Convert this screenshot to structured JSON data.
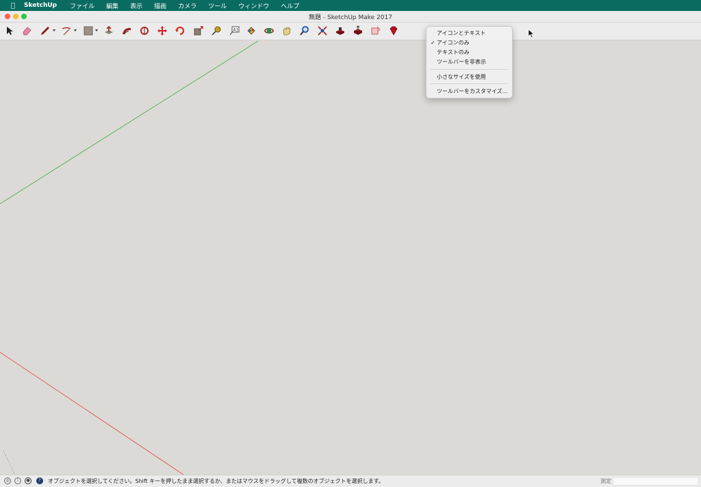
{
  "menubar": {
    "app_name": "SketchUp",
    "items": [
      "ファイル",
      "編集",
      "表示",
      "描画",
      "カメラ",
      "ツール",
      "ウィンドウ",
      "ヘルプ"
    ]
  },
  "window": {
    "title": "無題 - SketchUp Make 2017"
  },
  "toolbar": {
    "tools": [
      {
        "name": "select-tool",
        "icon": "arrow-icon",
        "color": "#222222"
      },
      {
        "name": "eraser-tool",
        "icon": "eraser-icon",
        "color": "#e06a8a"
      },
      {
        "name": "line-tool",
        "icon": "pencil-icon",
        "color": "#8b1a1a"
      },
      {
        "name": "arc-tool",
        "icon": "arc-icon",
        "color": "#b03030"
      },
      {
        "name": "shape-tool",
        "icon": "rectangle-icon",
        "color": "#8a7f72"
      },
      {
        "name": "push-pull-tool",
        "icon": "push-pull-icon",
        "color": "#b02020"
      },
      {
        "name": "offset-tool",
        "icon": "offset-icon",
        "color": "#a02020"
      },
      {
        "name": "follow-me-tool",
        "icon": "follow-me-icon",
        "color": "#c02020"
      },
      {
        "name": "move-tool",
        "icon": "move-icon",
        "color": "#d42020"
      },
      {
        "name": "rotate-tool",
        "icon": "rotate-icon",
        "color": "#d43020"
      },
      {
        "name": "scale-tool",
        "icon": "scale-icon",
        "color": "#b03020"
      },
      {
        "name": "tape-measure-tool",
        "icon": "tape-measure-icon",
        "color": "#c0a020"
      },
      {
        "name": "text-tool",
        "icon": "text-icon",
        "color": "#555555"
      },
      {
        "name": "paint-bucket-tool",
        "icon": "paint-bucket-icon",
        "color": "#2060a0"
      },
      {
        "name": "orbit-tool",
        "icon": "orbit-icon",
        "color": "#a02020"
      },
      {
        "name": "pan-tool",
        "icon": "pan-hand-icon",
        "color": "#d4b060"
      },
      {
        "name": "zoom-tool",
        "icon": "magnifier-icon",
        "color": "#2050a0"
      },
      {
        "name": "zoom-extents-tool",
        "icon": "zoom-extents-icon",
        "color": "#b02020"
      },
      {
        "name": "warehouse-tool",
        "icon": "3d-warehouse-icon",
        "color": "#a02020"
      },
      {
        "name": "share-model-tool",
        "icon": "share-model-icon",
        "color": "#a02020"
      },
      {
        "name": "extension-warehouse-tool",
        "icon": "extension-icon",
        "color": "#e08080"
      },
      {
        "name": "ruby-tool",
        "icon": "ruby-icon",
        "color": "#c01020"
      }
    ]
  },
  "context_menu": {
    "items": [
      {
        "label": "アイコンとテキスト",
        "checked": false
      },
      {
        "label": "アイコンのみ",
        "checked": true
      },
      {
        "label": "テキストのみ",
        "checked": false
      },
      {
        "label": "ツールバーを非表示",
        "checked": false
      },
      {
        "label": "小さなサイズを使用",
        "checked": false
      },
      {
        "label": "ツールバーをカスタマイズ...",
        "checked": false
      }
    ],
    "check_mark": "✓"
  },
  "canvas": {
    "axis_colors": {
      "green": "#4caf50",
      "red": "#e05050",
      "blue_dotted": "#8c8c8c"
    }
  },
  "statusbar": {
    "hint": "オブジェクトを選択してください。Shift キーを押したまま選択するか、またはマウスをドラッグして複数のオブジェクトを選択します。",
    "measure_label": "測定",
    "measure_value": ""
  }
}
